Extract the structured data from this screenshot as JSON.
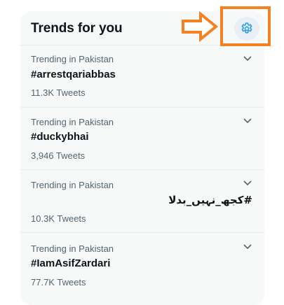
{
  "panel": {
    "title": "Trends for you"
  },
  "icons": {
    "settings": "gear-icon",
    "more": "chevron-down-icon"
  },
  "colors": {
    "accent": "#1d9bf0",
    "annotation": "#f58220",
    "panel_bg": "#f7f9f9",
    "text_primary": "#0f1419",
    "text_secondary": "#536471"
  },
  "trends": [
    {
      "context": "Trending in Pakistan",
      "name": "#arrestqariabbas",
      "count": "11.3K Tweets"
    },
    {
      "context": "Trending in Pakistan",
      "name": "#duckybhai",
      "count": "3,946 Tweets"
    },
    {
      "context": "Trending in Pakistan",
      "name": "#كجھ_نہیں_بدلا",
      "count": "10.3K Tweets"
    },
    {
      "context": "Trending in Pakistan",
      "name": "#IamAsifZardari",
      "count": "77.7K Tweets"
    }
  ]
}
